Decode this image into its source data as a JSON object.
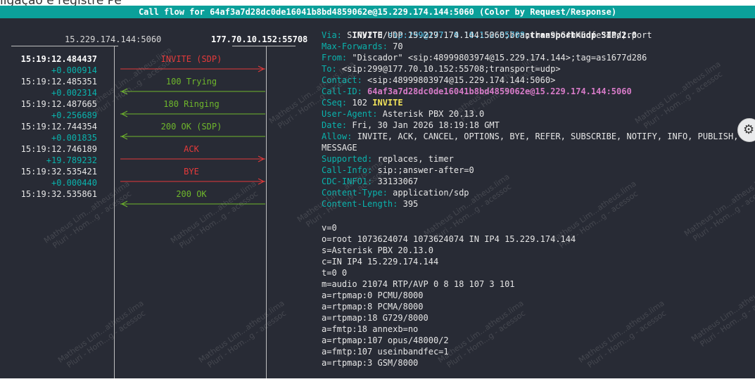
{
  "page_top_text": "ligação e registre Pe",
  "title_bar": {
    "text": "Call flow for 64af3a7d28dc0de16041b8bd4859062e@15.229.174.144:5060 (Color by Request/Response)",
    "color": "#0ba09a"
  },
  "flow": {
    "host_a": "15.229.174.144:5060",
    "host_b": "177.70.10.152:55708",
    "messages": [
      {
        "time": "15:19:12.484437",
        "delta": "+0.000914",
        "label": "INVITE (SDP)",
        "direction": "right",
        "color": "#e53a3a",
        "selected": true
      },
      {
        "time": "15:19:12.485351",
        "delta": "+0.002314",
        "label": "100 Trying",
        "direction": "left",
        "color": "#6fb72c",
        "selected": false
      },
      {
        "time": "15:19:12.487665",
        "delta": "+0.256689",
        "label": "180 Ringing",
        "direction": "left",
        "color": "#6fb72c",
        "selected": false
      },
      {
        "time": "15:19:12.744354",
        "delta": "+0.001835",
        "label": "200 OK (SDP)",
        "direction": "left",
        "color": "#6fb72c",
        "selected": false
      },
      {
        "time": "15:19:12.746189",
        "delta": "+19.789232",
        "label": "ACK",
        "direction": "right",
        "color": "#e53a3a",
        "selected": false
      },
      {
        "time": "15:19:32.535421",
        "delta": "+0.000440",
        "label": "BYE",
        "direction": "right",
        "color": "#e53a3a",
        "selected": false
      },
      {
        "time": "15:19:32.535861",
        "delta": "",
        "label": "200 OK",
        "direction": "left",
        "color": "#6fb72c",
        "selected": false
      }
    ]
  },
  "detail": {
    "request_line": {
      "method": "INVITE",
      "uri": "sip:299@177.70.10.152:55708",
      "rest": ";transport=udp SIP/2.0"
    },
    "headers": [
      {
        "key": "Via:",
        "value": " SIP/2.0/UDP 15.229.174.144:5060;branch=z9hG4bK5dfe3dad;rport"
      },
      {
        "key": "Max-Forwards:",
        "value": " 70"
      },
      {
        "key": "From:",
        "value": " \"Discador\" <sip:48999803974@15.229.174.144>;tag=as1677d286"
      },
      {
        "key": "To:",
        "value": " <sip:299@177.70.10.152:55708;transport=udp>"
      },
      {
        "key": "Contact:",
        "value": " <sip:48999803974@15.229.174.144:5060>"
      },
      {
        "key": "Call-ID:",
        "value": " 64af3a7d28dc0de16041b8bd4859062e@15.229.174.144:5060",
        "style": "callid"
      },
      {
        "key": "CSeq:",
        "value": " 102 ",
        "method": "INVITE"
      },
      {
        "key": "User-Agent:",
        "value": " Asterisk PBX 20.13.0"
      },
      {
        "key": "Date:",
        "value": " Fri, 30 Jan 2026 18:19:18 GMT"
      },
      {
        "key": "Allow:",
        "value": " INVITE, ACK, CANCEL, OPTIONS, BYE, REFER, SUBSCRIBE, NOTIFY, INFO, PUBLISH,"
      },
      {
        "key": "",
        "value": "MESSAGE"
      },
      {
        "key": "Supported:",
        "value": " replaces, timer"
      },
      {
        "key": "Call-Info:",
        "value": " sip:;answer-after=0"
      },
      {
        "key": "CDC-INFO1:",
        "value": " 33133067"
      },
      {
        "key": "Content-Type:",
        "value": " application/sdp"
      },
      {
        "key": "Content-Length:",
        "value": " 395"
      }
    ],
    "body": [
      "v=0",
      "o=root 1073624074 1073624074 IN IP4 15.229.174.144",
      "s=Asterisk PBX 20.13.0",
      "c=IN IP4 15.229.174.144",
      "t=0 0",
      "m=audio 21074 RTP/AVP 0 8 18 107 3 101",
      "a=rtpmap:0 PCMU/8000",
      "a=rtpmap:8 PCMA/8000",
      "a=rtpmap:18 G729/8000",
      "a=fmtp:18 annexb=no",
      "a=rtpmap:107 opus/48000/2",
      "a=fmtp:107 useinbandfec=1",
      "a=rtpmap:3 GSM/8000"
    ]
  },
  "watermark": {
    "line1": "Matheus Lim...atheus.lima",
    "line2": "Pluri - Hom...g - acessoc"
  },
  "settings_icon": "gear-icon"
}
